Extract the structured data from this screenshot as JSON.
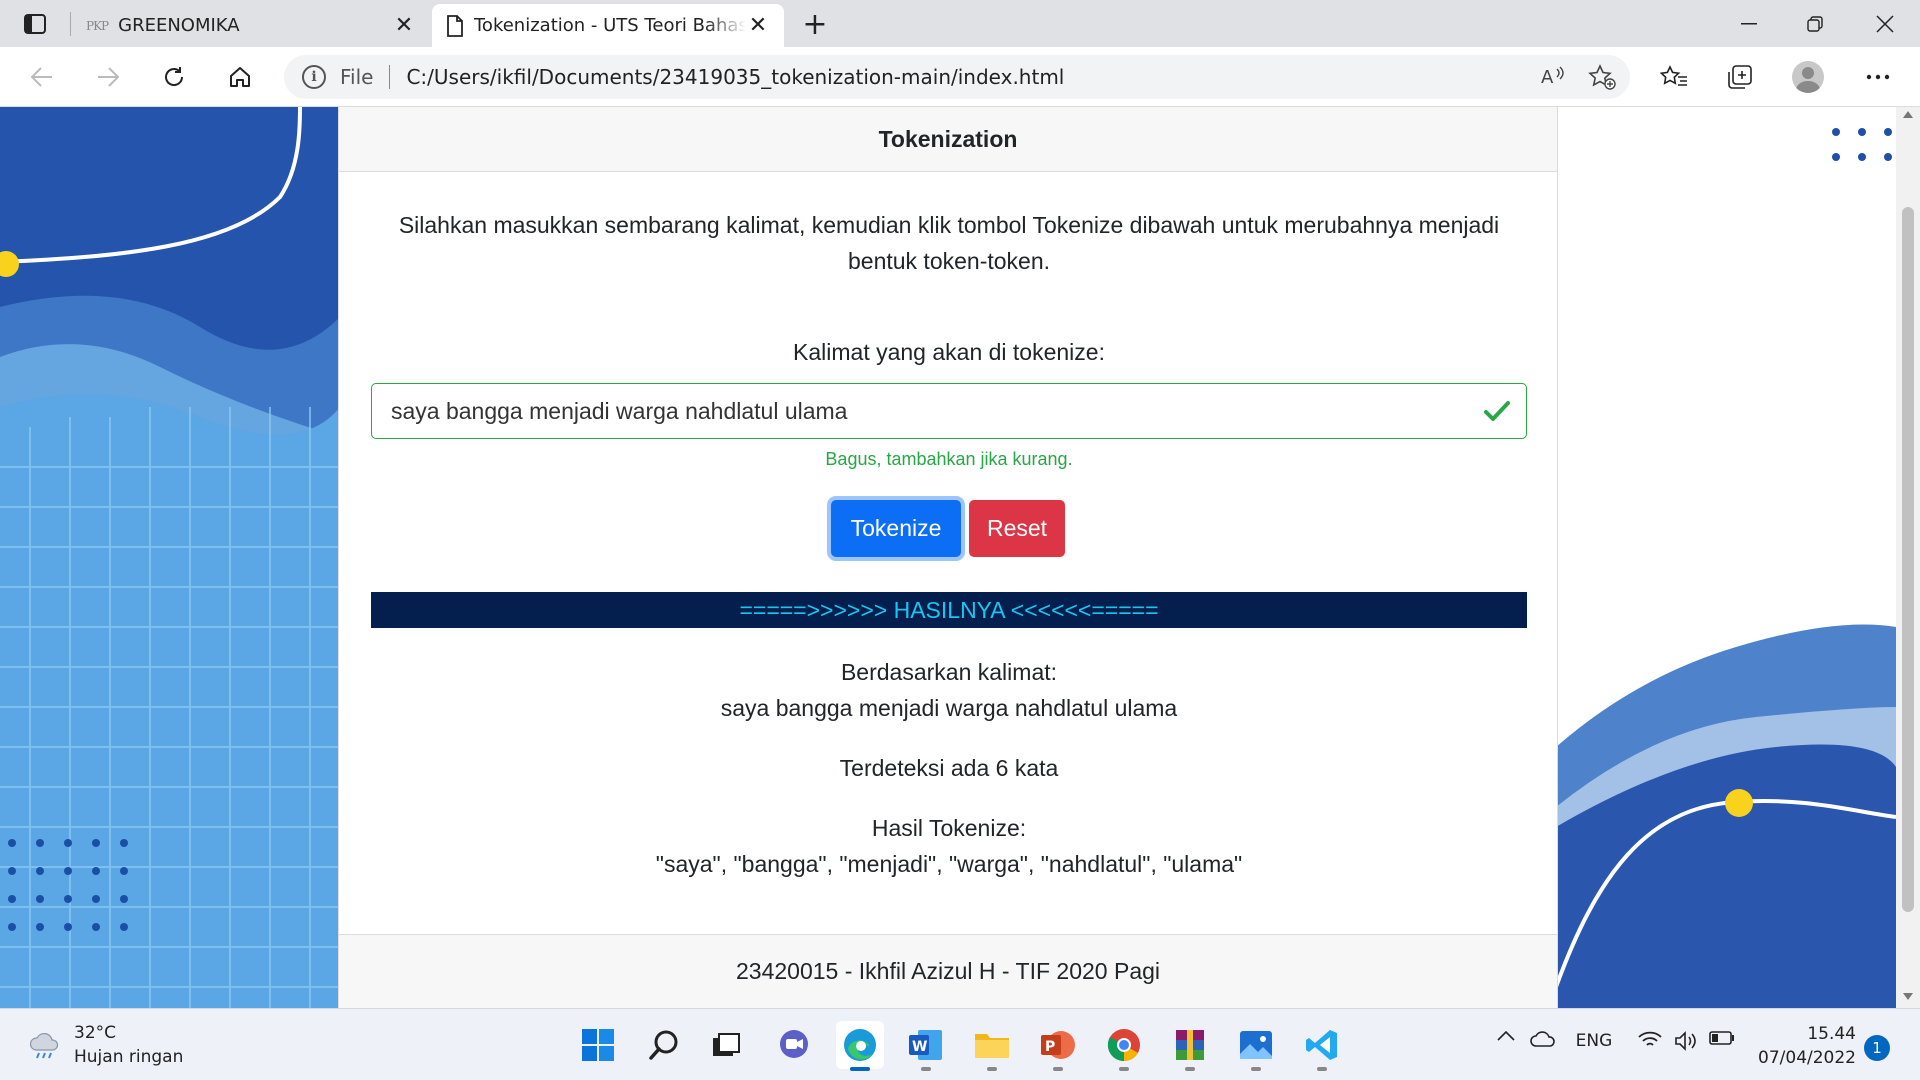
{
  "browser": {
    "tabs": [
      {
        "label": "GREENOMIKA",
        "favicon": "PKP",
        "active": false
      },
      {
        "label": "Tokenization - UTS Teori Bahasa dan Otomata",
        "active": true
      }
    ],
    "address": {
      "scheme_label": "File",
      "url": "C:/Users/ikfil/Documents/23419035_tokenization-main/index.html"
    },
    "icons": {
      "read_aloud": "read-aloud-icon",
      "add_favorite": "add-favorite-icon",
      "favorites": "favorites-icon",
      "collections": "collections-icon",
      "more": "more-icon"
    }
  },
  "page": {
    "header_title": "Tokenization",
    "instructions": "Silahkan masukkan sembarang kalimat, kemudian klik tombol Tokenize dibawah untuk merubahnya menjadi bentuk token-token.",
    "input_label": "Kalimat yang akan di tokenize:",
    "input_value": "saya bangga menjadi warga nahdlatul ulama",
    "valid_feedback": "Bagus, tambahkan jika kurang.",
    "buttons": {
      "tokenize": "Tokenize",
      "reset": "Reset"
    },
    "result_banner": "=====>>>>>> HASILNYA <<<<<<=====",
    "result": {
      "based_on_label": "Berdasarkan kalimat:",
      "sentence": "saya bangga menjadi warga nahdlatul ulama",
      "word_count_text": "Terdeteksi ada 6 kata",
      "tokens_label": "Hasil Tokenize:",
      "tokens_text": "\"saya\", \"bangga\", \"menjadi\", \"warga\", \"nahdlatul\", \"ulama\""
    },
    "footer": "23420015 - Ikhfil Azizul H - TIF 2020 Pagi"
  },
  "taskbar": {
    "weather": {
      "temp": "32°C",
      "condition": "Hujan ringan"
    },
    "tray": {
      "language": "ENG"
    },
    "clock": {
      "time": "15.44",
      "date": "07/04/2022"
    },
    "notifications": "1"
  },
  "colors": {
    "accent_blue": "#0b6ef5",
    "danger_red": "#dc3545",
    "success_green": "#28a745",
    "banner_bg": "#041e4e",
    "banner_text": "#17c7f2",
    "bg_blue": "#2a55b0"
  }
}
